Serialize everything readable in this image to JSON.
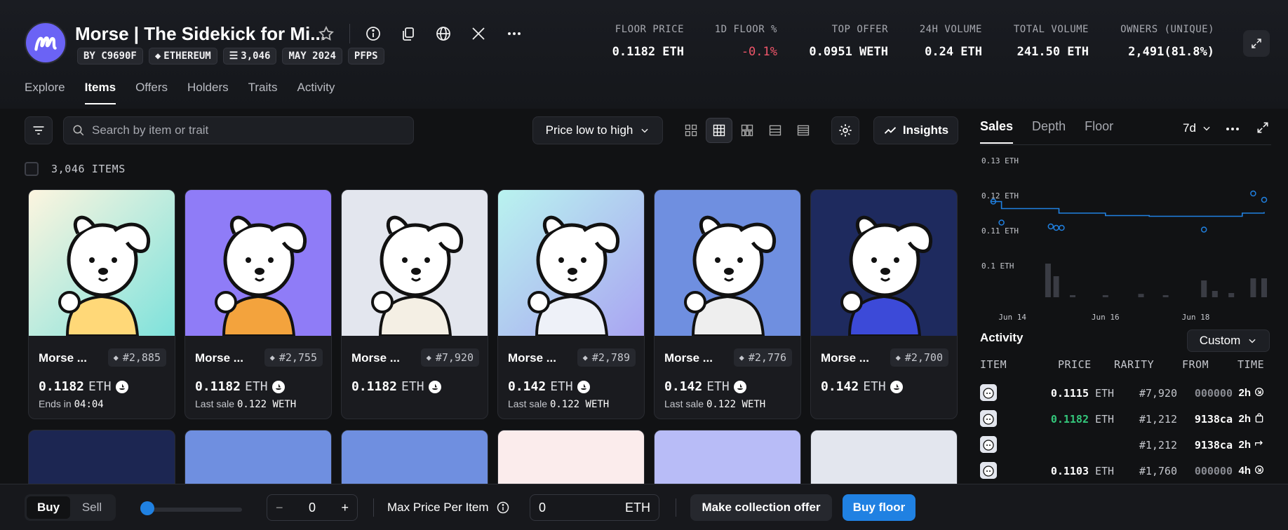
{
  "collection": {
    "title": "Morse | The Sidekick for Mi...",
    "badges": [
      "BY C9690F",
      "ETHEREUM",
      "3,046",
      "MAY 2024",
      "PFPS"
    ]
  },
  "stats": [
    {
      "label": "FLOOR PRICE",
      "value": "0.1182 ETH"
    },
    {
      "label": "1D FLOOR %",
      "value": "-0.1%"
    },
    {
      "label": "TOP OFFER",
      "value": "0.0951 WETH"
    },
    {
      "label": "24H VOLUME",
      "value": "0.24 ETH"
    },
    {
      "label": "TOTAL VOLUME",
      "value": "241.50 ETH"
    },
    {
      "label": "OWNERS (UNIQUE)",
      "value": "2,491(81.8%)"
    }
  ],
  "nav": [
    "Explore",
    "Items",
    "Offers",
    "Holders",
    "Traits",
    "Activity"
  ],
  "nav_active": "Items",
  "search": {
    "placeholder": "Search by item or trait"
  },
  "sort": {
    "label": "Price low to high"
  },
  "insights_label": "Insights",
  "items_count": "3,046 ITEMS",
  "cards": [
    {
      "name": "Morse ...",
      "token": "#2,885",
      "price": "0.1182",
      "unit": "ETH",
      "sub_label": "Ends in",
      "sub_value": "04:04",
      "bg": "gradient1"
    },
    {
      "name": "Morse ...",
      "token": "#2,755",
      "price": "0.1182",
      "unit": "ETH",
      "sub_label": "Last sale",
      "sub_value": "0.122 WETH",
      "bg": "#8f7cf7"
    },
    {
      "name": "Morse ...",
      "token": "#7,920",
      "price": "0.1182",
      "unit": "ETH",
      "sub_label": "",
      "sub_value": "",
      "bg": "#e3e6ee"
    },
    {
      "name": "Morse ...",
      "token": "#2,789",
      "price": "0.142",
      "unit": "ETH",
      "sub_label": "Last sale",
      "sub_value": "0.122 WETH",
      "bg": "gradient2"
    },
    {
      "name": "Morse ...",
      "token": "#2,776",
      "price": "0.142",
      "unit": "ETH",
      "sub_label": "Last sale",
      "sub_value": "0.122 WETH",
      "bg": "#6f8fe0"
    },
    {
      "name": "Morse ...",
      "token": "#2,700",
      "price": "0.142",
      "unit": "ETH",
      "sub_label": "",
      "sub_value": "",
      "bg": "#1e2a5e"
    }
  ],
  "panel": {
    "tabs": [
      "Sales",
      "Depth",
      "Floor"
    ],
    "active_tab": "Sales",
    "period": "7d",
    "activity_title": "Activity",
    "filter_label": "Custom",
    "columns": [
      "ITEM",
      "PRICE",
      "RARITY",
      "FROM",
      "TIME"
    ],
    "rows": [
      {
        "price": "0.1115",
        "unit": "ETH",
        "rarity": "#7,920",
        "from": "000000",
        "time": "2h",
        "event": "offer",
        "highlight": false
      },
      {
        "price": "0.1182",
        "unit": "ETH",
        "rarity": "#1,212",
        "from": "9138ca",
        "time": "2h",
        "event": "sale",
        "highlight": true
      },
      {
        "price": "",
        "unit": "",
        "rarity": "#1,212",
        "from": "9138ca",
        "time": "2h",
        "event": "transfer",
        "highlight": false
      },
      {
        "price": "0.1103",
        "unit": "ETH",
        "rarity": "#1,760",
        "from": "000000",
        "time": "4h",
        "event": "offer",
        "highlight": false
      }
    ]
  },
  "chart_data": {
    "type": "line",
    "y_tick_labels": [
      "0.13 ETH",
      "0.12 ETH",
      "0.11 ETH",
      "0.1 ETH"
    ],
    "y_ticks": [
      0.13,
      0.12,
      0.11,
      0.1
    ],
    "ylim": [
      0.093,
      0.133
    ],
    "x_tick_labels": [
      "Jun 14",
      "Jun 16",
      "Jun 18"
    ],
    "x_ticks": [
      0.08,
      0.42,
      0.75
    ],
    "floor_line": [
      [
        0.0,
        0.1195
      ],
      [
        0.04,
        0.1175
      ],
      [
        0.22,
        0.1175
      ],
      [
        0.25,
        0.1162
      ],
      [
        0.38,
        0.1162
      ],
      [
        0.42,
        0.1155
      ],
      [
        0.54,
        0.1155
      ],
      [
        0.58,
        0.1153
      ],
      [
        0.9,
        0.1153
      ],
      [
        0.92,
        0.1162
      ],
      [
        1.0,
        0.1165
      ]
    ],
    "scatter": [
      [
        0.01,
        0.1195
      ],
      [
        0.04,
        0.1135
      ],
      [
        0.22,
        0.1124
      ],
      [
        0.24,
        0.112
      ],
      [
        0.26,
        0.112
      ],
      [
        0.78,
        0.1115
      ],
      [
        0.96,
        0.1218
      ],
      [
        1.0,
        0.12
      ]
    ],
    "volume_bars": [
      [
        0.21,
        0.8
      ],
      [
        0.24,
        0.5
      ],
      [
        0.3,
        0.05
      ],
      [
        0.42,
        0.05
      ],
      [
        0.55,
        0.08
      ],
      [
        0.64,
        0.05
      ],
      [
        0.78,
        0.4
      ],
      [
        0.82,
        0.15
      ],
      [
        0.88,
        0.1
      ],
      [
        0.96,
        0.45
      ],
      [
        1.0,
        0.45
      ]
    ]
  },
  "bottom": {
    "buy_label": "Buy",
    "sell_label": "Sell",
    "quantity": "0",
    "max_price_label": "Max Price Per Item",
    "max_price_value": "0",
    "max_price_unit": "ETH",
    "offer_label": "Make collection offer",
    "floor_label": "Buy floor"
  },
  "colors": {
    "accent": "#2081e2",
    "negative": "#f0566a",
    "positive": "#34c77b",
    "logo": "#6b63f5"
  }
}
